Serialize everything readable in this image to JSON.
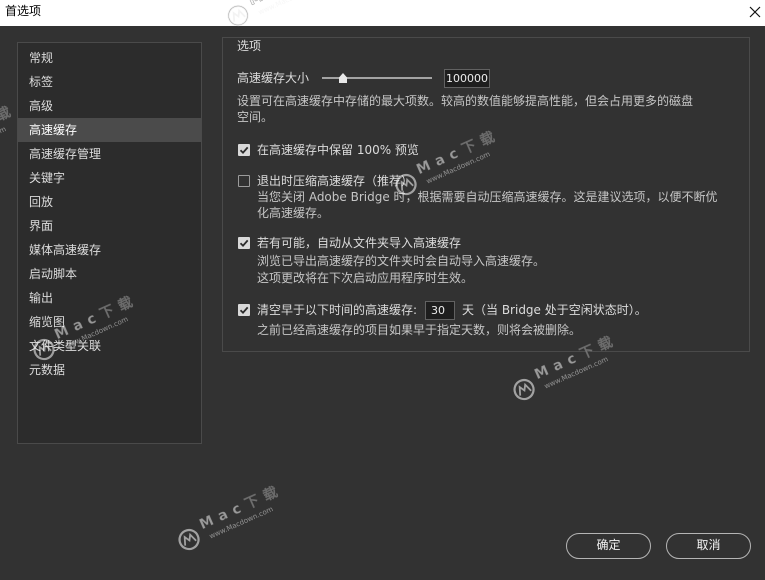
{
  "window": {
    "title": "首选项",
    "close_icon": "close-icon"
  },
  "sidebar": {
    "items": [
      "常规",
      "标签",
      "高级",
      "高速缓存",
      "高速缓存管理",
      "关键字",
      "回放",
      "界面",
      "媒体高速缓存",
      "启动脚本",
      "输出",
      "缩览图",
      "文件类型关联",
      "元数据"
    ],
    "selected_index": 3
  },
  "options": {
    "group_label": "选项",
    "cache_size": {
      "label": "高速缓存大小",
      "value": "100000",
      "slider_level": 0.19,
      "description": [
        "设置可在高速缓存中存储的最大项数。较高的数值能够提高性能，但会占用更多的磁盘",
        "空间。"
      ]
    },
    "keep_previews": {
      "label": "在高速缓存中保留 100% 预览",
      "checked": true
    },
    "compact_on_exit": {
      "label": "退出时压缩高速缓存（推荐）",
      "checked": false,
      "description": [
        "当您关闭 Adobe Bridge 时，根据需要自动压缩高速缓存。这是建议选项，以便不断优",
        "化高速缓存。"
      ]
    },
    "auto_import": {
      "label": "若有可能，自动从文件夹导入高速缓存",
      "checked": true,
      "description": [
        "浏览已导出高速缓存的文件夹时会自动导入高速缓存。",
        "这项更改将在下次启动应用程序时生效。"
      ]
    },
    "purge_older": {
      "label": "清空早于以下时间的高速缓存:",
      "checked": true,
      "days": "30",
      "suffix": "天（当 Bridge 处于空闲状态时）。",
      "description": [
        "之前已经高速缓存的项目如果早于指定天数，则将会被删除。"
      ]
    }
  },
  "buttons": {
    "ok": "确定",
    "cancel": "取消"
  },
  "watermark": {
    "brand": "Mac下载",
    "url": "www.Macdown.com",
    "logo_icon": "macdown-logo-icon"
  },
  "colors": {
    "background": "#323232",
    "sidebar_background": "#2c2c2c",
    "panel_border": "#4a4a4a",
    "selected_item": "#4b4b4b",
    "text": "#dcdcdc",
    "description_text": "#c6c6c6",
    "title_bar": "#ffffff",
    "button_border": "#b5b5b5",
    "checkbox_checked": "#d9d9d9"
  }
}
